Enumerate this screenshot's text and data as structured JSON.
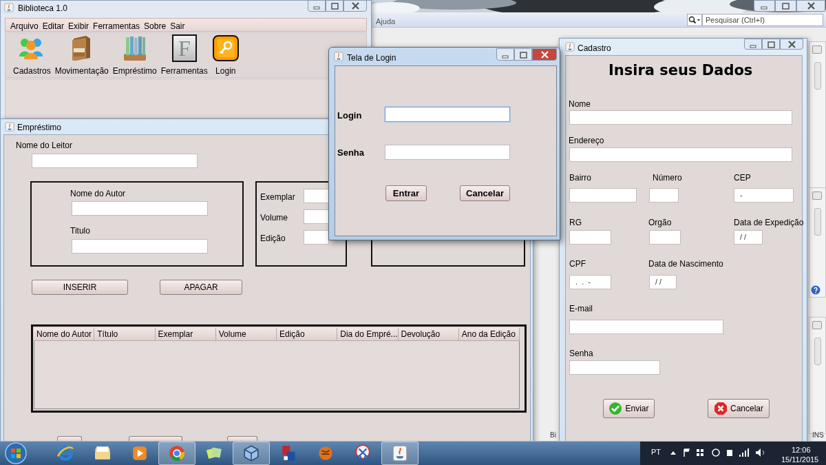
{
  "main_window": {
    "title": "Biblioteca 1.0",
    "menu": [
      "Arquivo",
      "Editar",
      "Exibir",
      "Ferramentas",
      "Sobre",
      "Sair"
    ],
    "toolbar": [
      {
        "label": "Cadastros"
      },
      {
        "label": "Movimentação"
      },
      {
        "label": "Empréstimo"
      },
      {
        "label": "Ferramentas",
        "glyph": "F"
      },
      {
        "label": "Login"
      }
    ]
  },
  "ide_window": {
    "menu": [
      "Ajuda"
    ],
    "search": {
      "placeholder": "Pesquisar (Ctrl+I)"
    },
    "status": [
      "Bi",
      "INS"
    ]
  },
  "loan_window": {
    "title": "Empréstimo",
    "reader": {
      "label": "Nome do Leitor"
    },
    "book": [
      {
        "label": "Nome do Autor"
      },
      {
        "label": "Titulo"
      }
    ],
    "copy": [
      {
        "label": "Exemplar"
      },
      {
        "label": "Volume"
      },
      {
        "label": "Edição"
      }
    ],
    "buttons": [
      "INSERIR",
      "APAGAR"
    ],
    "table": {
      "columns": [
        "Nome do Autor",
        "Título",
        "Exemplar",
        "Volume",
        "Edição",
        "Dia do Empré...",
        "Devolução",
        "Ano da Edição"
      ]
    }
  },
  "login_window": {
    "title": "Tela de Login",
    "fields": [
      {
        "label": "Login",
        "focused": true
      },
      {
        "label": "Senha",
        "focused": false
      }
    ],
    "buttons": [
      "Entrar",
      "Cancelar"
    ]
  },
  "register_window": {
    "title": "Cadastro",
    "heading": "Insira seus Dados",
    "fields": [
      {
        "label": "Nome"
      },
      {
        "label": "Endereço"
      },
      {
        "label": "Bairro"
      },
      {
        "label": "Número"
      },
      {
        "label": "CEP",
        "value": "-"
      },
      {
        "label": "RG"
      },
      {
        "label": "Orgão"
      },
      {
        "label": "Data de Expedição",
        "value": "/ /"
      },
      {
        "label": "CPF",
        "value": ".  .  -"
      },
      {
        "label": "Data de Nascimento",
        "value": "/ /"
      },
      {
        "label": "E-mail"
      },
      {
        "label": "Senha"
      }
    ],
    "buttons": [
      {
        "label": "Enviar",
        "kind": "confirm"
      },
      {
        "label": "Cancelar",
        "kind": "cancel"
      }
    ]
  },
  "taskbar": {
    "apps": [
      {
        "running": false
      },
      {
        "running": false
      },
      {
        "running": false
      },
      {
        "running": true
      },
      {
        "running": false
      },
      {
        "running": true
      },
      {
        "running": false
      },
      {
        "running": false
      },
      {
        "running": false
      },
      {
        "running": true
      }
    ],
    "language": "PT",
    "time": "12:06",
    "date": "15/11/2015"
  }
}
